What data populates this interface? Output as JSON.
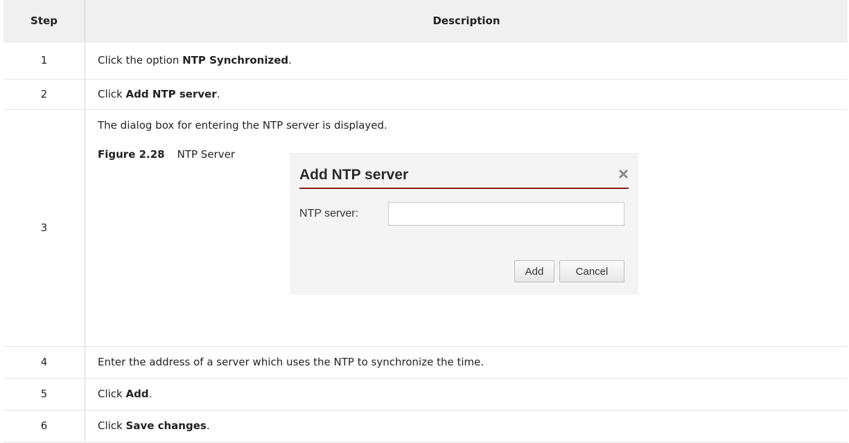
{
  "table": {
    "header": {
      "step": "Step",
      "description": "Description"
    },
    "rows": [
      {
        "step": "1",
        "pre": "Click the option ",
        "bold": "NTP Synchronized",
        "post": "."
      },
      {
        "step": "2",
        "pre": "Click ",
        "bold": "Add NTP server",
        "post": "."
      },
      {
        "step": "3",
        "text": "The dialog box for entering the NTP server is displayed."
      },
      {
        "step": "4",
        "text": "Enter the address of a server which uses the NTP to synchronize the time."
      },
      {
        "step": "5",
        "pre": "Click ",
        "bold": "Add",
        "post": "."
      },
      {
        "step": "6",
        "pre": "Click ",
        "bold": "Save changes",
        "post": "."
      }
    ]
  },
  "figure": {
    "number": "Figure 2.28",
    "caption": "NTP Server"
  },
  "dialog": {
    "title": "Add NTP server",
    "close_icon": "×",
    "field_label": "NTP server:",
    "field_value": "",
    "add_label": "Add",
    "cancel_label": "Cancel"
  },
  "colors": {
    "header_bg": "#f0f0f0",
    "dialog_rule": "#8b1a1a"
  }
}
